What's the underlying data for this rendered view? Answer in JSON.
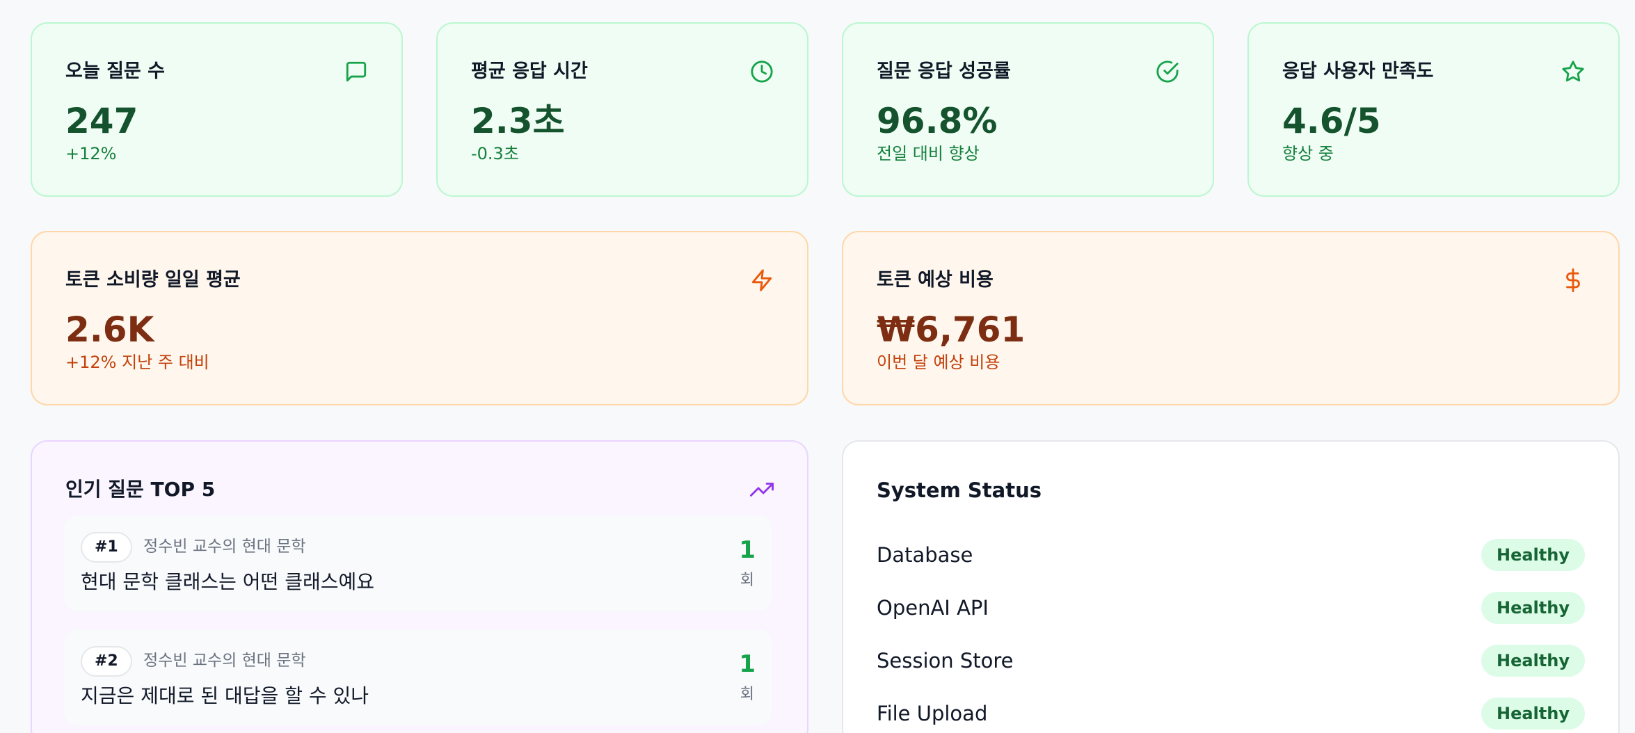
{
  "stats": [
    {
      "title": "오늘 질문 수",
      "value": "247",
      "sub": "+12%",
      "icon": "message-square-icon"
    },
    {
      "title": "평균 응답 시간",
      "value": "2.3초",
      "sub": "-0.3초",
      "icon": "clock-icon"
    },
    {
      "title": "질문 응답 성공률",
      "value": "96.8%",
      "sub": "전일 대비 향상",
      "icon": "check-circle-icon"
    },
    {
      "title": "응답 사용자 만족도",
      "value": "4.6/5",
      "sub": "향상 중",
      "icon": "star-icon"
    }
  ],
  "tokens": [
    {
      "title": "토큰 소비량 일일 평균",
      "value": "2.6K",
      "sub": "+12% 지난 주 대비",
      "icon": "zap-icon"
    },
    {
      "title": "토큰 예상 비용",
      "value": "₩6,761",
      "sub": "이번 달 예상 비용",
      "icon": "dollar-icon"
    }
  ],
  "top_questions": {
    "title": "인기 질문 TOP 5",
    "icon": "trending-up-icon",
    "items": [
      {
        "rank": "#1",
        "source": "정수빈 교수의 현대 문학",
        "text": "현대 문학 클래스는 어떤 클래스예요",
        "count": "1",
        "unit": "회"
      },
      {
        "rank": "#2",
        "source": "정수빈 교수의 현대 문학",
        "text": "지금은 제대로 된 대답을 할 수 있나",
        "count": "1",
        "unit": "회"
      }
    ]
  },
  "system_status": {
    "title": "System Status",
    "services": [
      {
        "name": "Database",
        "status": "Healthy"
      },
      {
        "name": "OpenAI API",
        "status": "Healthy"
      },
      {
        "name": "Session Store",
        "status": "Healthy"
      },
      {
        "name": "File Upload",
        "status": "Healthy"
      }
    ]
  },
  "colors": {
    "green_accent": "#16a34a",
    "orange_accent": "#ea580c",
    "purple_accent": "#9333ea"
  }
}
